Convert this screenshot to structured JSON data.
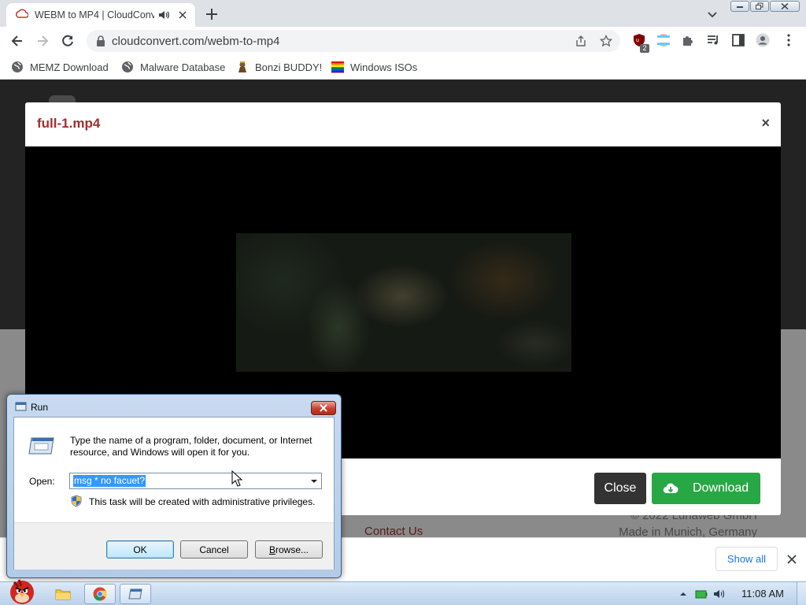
{
  "browser": {
    "tab": {
      "title": "WEBM to MP4 | CloudConv",
      "favicon": "cloudconvert-icon",
      "audio_icon": "speaker-icon",
      "close_icon": "close-icon"
    },
    "new_tab_icon": "plus-icon",
    "tab_search_icon": "chevron-down-icon",
    "window_controls": [
      "minimize-icon",
      "restore-icon",
      "close-icon"
    ],
    "nav": [
      "back-arrow-icon",
      "forward-arrow-icon",
      "reload-icon"
    ],
    "url": "cloudconvert.com/webm-to-mp4",
    "toolbar_icons": [
      "share-icon",
      "star-icon",
      "ublock-icon",
      "extension-icon",
      "puzzle-icon",
      "media-queue-icon",
      "side-panel-icon",
      "profile-icon",
      "kebab-menu-icon"
    ],
    "extension_badge": "2",
    "bookmarks": [
      {
        "label": "MEMZ Download",
        "icon": "globe-icon"
      },
      {
        "label": "Malware Database",
        "icon": "globe-icon"
      },
      {
        "label": "Bonzi BUDDY!",
        "icon": "bonzi-icon"
      },
      {
        "label": "Windows ISOs",
        "icon": "rainbow-flag-icon"
      }
    ]
  },
  "site": {
    "contact": "Contact Us",
    "copyright": "© 2022 Lunaweb GmbH",
    "location": "Made in Munich, Germany"
  },
  "modal": {
    "title": "full-1.mp4",
    "close_glyph": "×",
    "close_label": "Close",
    "download_label": "Download",
    "download_icon": "cloud-download-icon"
  },
  "shelf": {
    "show_all": "Show all"
  },
  "taskbar": {
    "apps": [
      "start-orb-icon",
      "folder-icon",
      "chrome-icon",
      "run-window-icon"
    ],
    "tray": [
      "show-hidden-icons-icon",
      "battery-icon",
      "volume-icon"
    ],
    "time": "11:08 AM"
  },
  "run_dialog": {
    "title": "Run",
    "description_line1": "Type the name of a program, folder, document, or Internet",
    "description_line2": "resource, and Windows will open it for you.",
    "open_label": "Open:",
    "input_value": "msg * no facuet?",
    "privilege_note": "This task will be created with administrative privileges.",
    "ok_label": "OK",
    "cancel_label": "Cancel",
    "browse_mnemonic": "B",
    "browse_rest": "rowse...",
    "selection_color": "#3399ff"
  },
  "colors": {
    "modal_title": "#a0302e",
    "download_button": "#28a745",
    "close_button": "#333333",
    "link_blue": "#1a73e8"
  }
}
